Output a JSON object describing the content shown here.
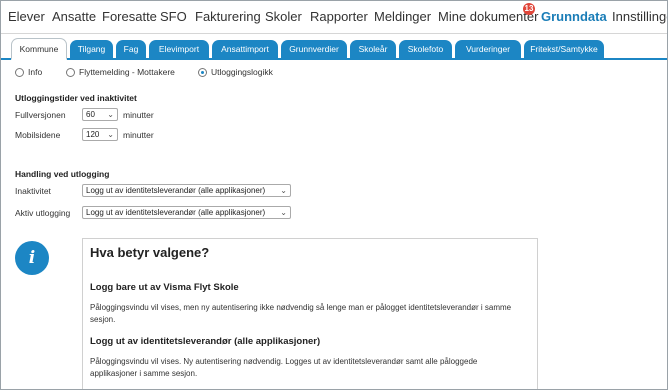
{
  "topnav": {
    "items": [
      {
        "label": "Elever"
      },
      {
        "label": "Ansatte"
      },
      {
        "label": "Foresatte"
      },
      {
        "label": "SFO"
      },
      {
        "label": "Fakturering"
      },
      {
        "label": "Skoler"
      },
      {
        "label": "Rapporter"
      },
      {
        "label": "Meldinger"
      },
      {
        "label": "Mine dokumenter"
      },
      {
        "label": "Grunndata"
      },
      {
        "label": "Innstillinger"
      }
    ],
    "badge_count": "13",
    "active": "Grunndata"
  },
  "tabs": [
    {
      "label": "Kommune"
    },
    {
      "label": "Tilgang"
    },
    {
      "label": "Fag"
    },
    {
      "label": "Elevimport"
    },
    {
      "label": "Ansattimport"
    },
    {
      "label": "Grunnverdier"
    },
    {
      "label": "Skoleår"
    },
    {
      "label": "Skolefoto"
    },
    {
      "label": "Vurderinger"
    },
    {
      "label": "Fritekst/Samtykke"
    }
  ],
  "radio_options": [
    {
      "label": "Info",
      "selected": false
    },
    {
      "label": "Flyttemelding - Mottakere",
      "selected": false
    },
    {
      "label": "Utloggingslogikk",
      "selected": true
    }
  ],
  "timeouts": {
    "heading": "Utloggingstider ved inaktivitet",
    "rows": [
      {
        "label": "Fullversjonen",
        "value": "60",
        "unit": "minutter"
      },
      {
        "label": "Mobilsidene",
        "value": "120",
        "unit": "minutter"
      }
    ]
  },
  "logout_handling": {
    "heading": "Handling ved utlogging",
    "rows": [
      {
        "label": "Inaktivitet",
        "value": "Logg ut av identitetsleverandør (alle applikasjoner)"
      },
      {
        "label": "Aktiv utlogging",
        "value": "Logg ut av identitetsleverandør (alle applikasjoner)"
      }
    ]
  },
  "info": {
    "icon_letter": "i",
    "title": "Hva betyr valgene?",
    "sections": [
      {
        "heading": "Logg bare ut av Visma Flyt Skole",
        "text": "Påloggingsvindu vil vises, men ny autentisering ikke nødvendig så lenge man er pålogget identitetsleverandør i samme sesjon."
      },
      {
        "heading": "Logg ut av identitetsleverandør (alle applikasjoner)",
        "text": "Påloggingsvindu vil vises. Ny autentisering nødvendig. Logges ut av identitetsleverandør samt alle påloggede applikasjoner i samme sesjon."
      }
    ]
  },
  "colors": {
    "accent": "#1c86c4",
    "badge": "#e0463a"
  }
}
